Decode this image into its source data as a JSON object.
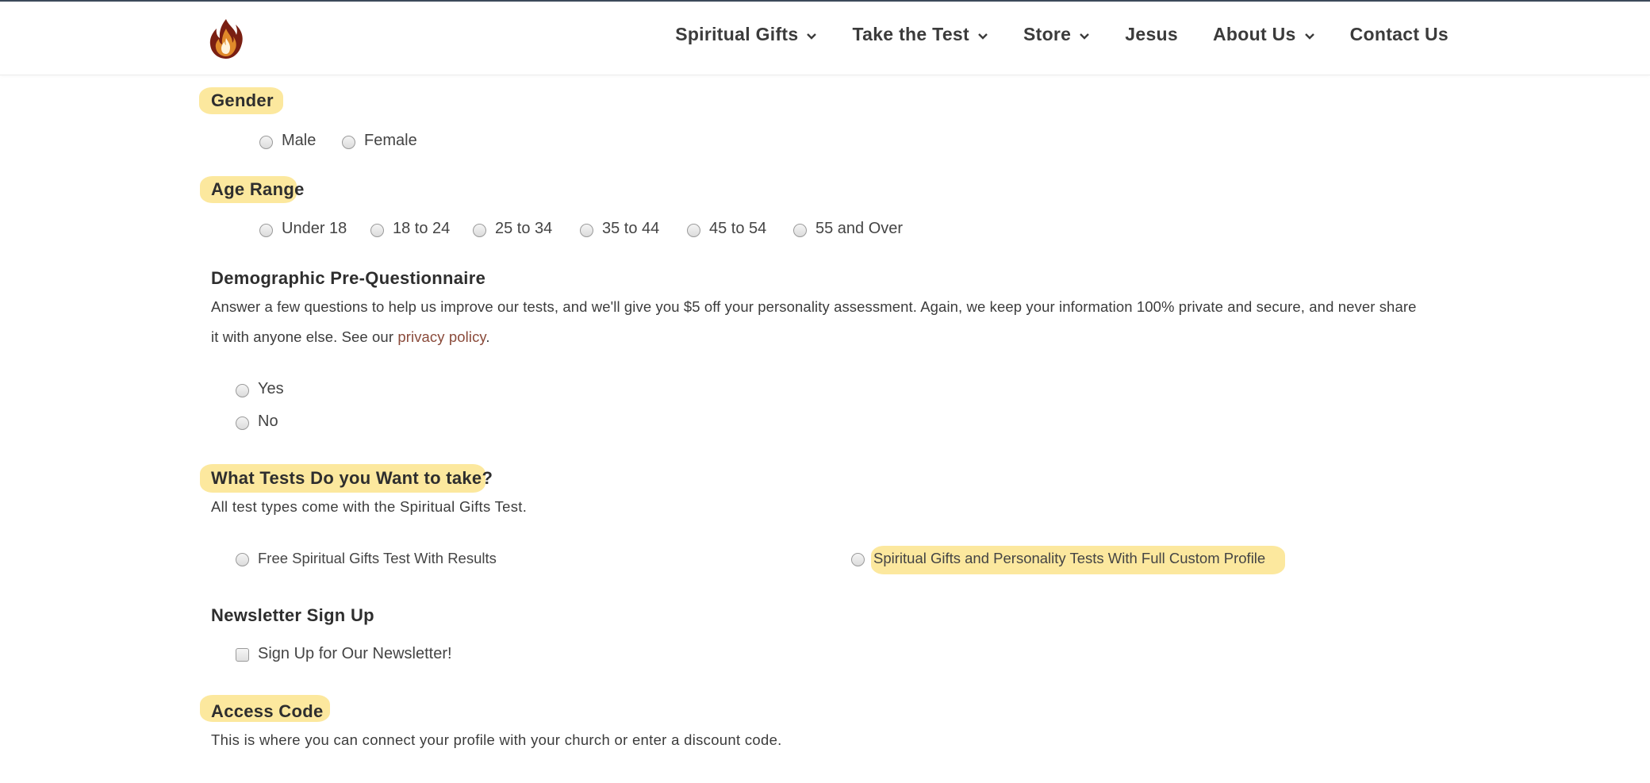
{
  "nav": {
    "items": [
      {
        "label": "Spiritual Gifts",
        "has_dropdown": true
      },
      {
        "label": "Take the Test",
        "has_dropdown": true
      },
      {
        "label": "Store",
        "has_dropdown": true
      },
      {
        "label": "Jesus",
        "has_dropdown": false
      },
      {
        "label": "About Us",
        "has_dropdown": true
      },
      {
        "label": "Contact Us",
        "has_dropdown": false
      }
    ],
    "logo_icon": "flame-logo-icon"
  },
  "colors": {
    "highlight": "#fbe48d",
    "logo_dark": "#7a1f12",
    "logo_accent": "#e08a2a",
    "link": "#8a4a3a"
  },
  "form": {
    "gender": {
      "heading": "Gender",
      "options": [
        "Male",
        "Female"
      ]
    },
    "age": {
      "heading": "Age Range",
      "options": [
        "Under 18",
        "18 to 24",
        "25 to 34",
        "35 to 44",
        "45 to 54",
        "55 and Over"
      ]
    },
    "demographic": {
      "heading": "Demographic Pre-Questionnaire",
      "desc_line1": "Answer a few questions to help us improve our tests, and we'll give you $5 off your personality assessment. Again, we keep your information 100% private and secure, and never share",
      "desc_line2_prefix": "it with anyone else. See our ",
      "privacy_link": "privacy policy",
      "desc_line2_suffix": ".",
      "options": [
        "Yes",
        "No"
      ]
    },
    "tests": {
      "heading": "What Tests Do you Want to take?",
      "subtitle": "All test types come with the Spiritual Gifts Test.",
      "options": [
        "Free Spiritual Gifts Test With Results",
        "Spiritual Gifts and Personality Tests With Full Custom Profile"
      ]
    },
    "newsletter": {
      "heading": "Newsletter Sign Up",
      "checkbox_label": "Sign Up for Our Newsletter!"
    },
    "access": {
      "heading": "Access Code",
      "desc": "This is where you can connect your profile with your church or enter a discount code."
    }
  }
}
